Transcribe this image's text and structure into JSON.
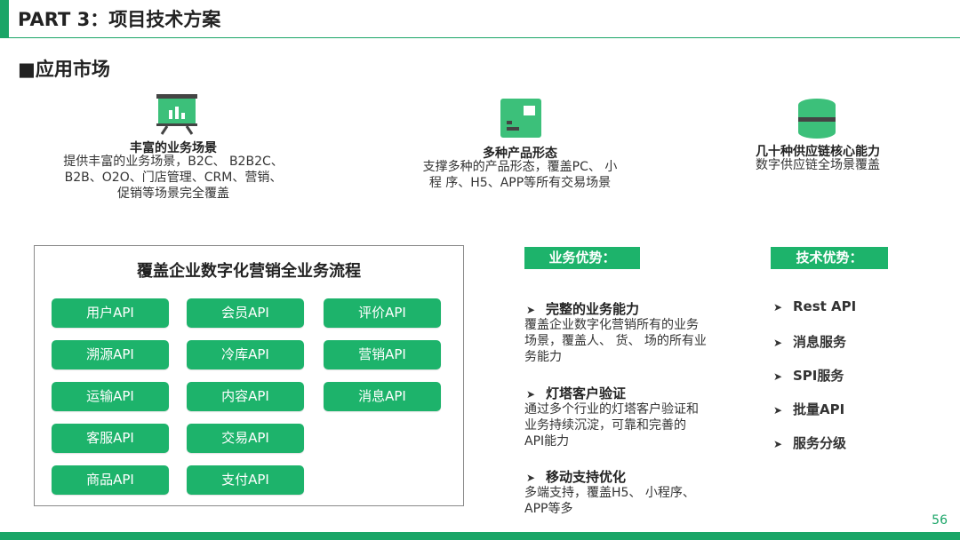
{
  "header": {
    "title": "PART 3：项目技术方案"
  },
  "section": {
    "title": "■应用市场"
  },
  "features": [
    {
      "icon": "presentation-board-icon",
      "title": "丰富的业务场景",
      "desc": [
        "提供丰富的业务场景，B2C、 B2B2C、",
        "B2B、O2O、门店管理、CRM、营销、",
        "促销等场景完全覆盖"
      ]
    },
    {
      "icon": "browser-window-icon",
      "title": "多种产品形态",
      "desc": [
        "支撑多种的产品形态，覆盖PC、 小",
        "程 序、H5、APP等所有交易场景"
      ]
    },
    {
      "icon": "database-icon",
      "title": "几十种供应链核心能力",
      "desc": [
        "数字供应链全场景覆盖"
      ]
    }
  ],
  "flow": {
    "title": "覆盖企业数字化营销全业务流程",
    "apis": [
      [
        "用户API",
        "会员API",
        "评价API"
      ],
      [
        "溯源API",
        "冷库API",
        "营销API"
      ],
      [
        "运输API",
        "内容API",
        "消息API"
      ],
      [
        "客服API",
        "交易API"
      ],
      [
        "商品API",
        "支付API"
      ]
    ]
  },
  "business": {
    "badge": "业务优势：",
    "items": [
      {
        "title": "完整的业务能力",
        "desc": [
          "覆盖企业数字化营销所有的业务",
          "场景，覆盖人、 货、 场的所有业",
          "务能力"
        ]
      },
      {
        "title": "灯塔客户验证",
        "desc": [
          "通过多个行业的灯塔客户验证和",
          "业务持续沉淀，可靠和完善的",
          "API能力"
        ]
      },
      {
        "title": "移动支持优化",
        "desc": [
          "多端支持，覆盖H5、 小程序、",
          "APP等多"
        ]
      }
    ]
  },
  "tech": {
    "badge": "技术优势：",
    "items": [
      "Rest API",
      "消息服务",
      "SPI服务",
      "批量API",
      "服务分级"
    ]
  },
  "bullet_glyph": "➤",
  "page_number": "56",
  "colors": {
    "accent": "#1aa567",
    "button": "#1db36b"
  }
}
